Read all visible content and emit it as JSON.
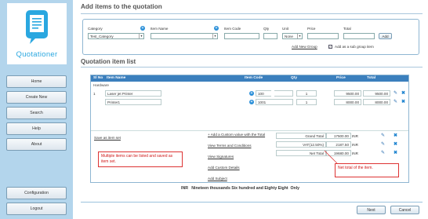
{
  "sidebar": {
    "logo_text": "Quotationer",
    "nav": [
      "Home",
      "Create New",
      "Search",
      "Help",
      "About"
    ],
    "bottom": [
      "Configuration",
      "Logout"
    ]
  },
  "header": {
    "title": "Add items to the quotation"
  },
  "form": {
    "category_label": "Category",
    "category_value": "Test_Category",
    "item_name_label": "Item Name",
    "item_name_value": "",
    "item_code_label": "Item Code",
    "qty_label": "Qty",
    "unit_label": "Unit",
    "unit_value": "None",
    "price_label": "Price",
    "total_label": "Total",
    "add_label": "Add",
    "add_new_group": "Add New Group",
    "add_sub_group": "Add as a sub group item",
    "sub_group_checked": true
  },
  "list": {
    "title": "Quotation item list",
    "headers": [
      "Sl No",
      "Item Name",
      "Item Code",
      "Qty",
      "Price",
      "Total"
    ],
    "group": "Hardware",
    "rows": [
      {
        "sl": "1",
        "name": "Laser jet Printer",
        "code": "100",
        "qty": "1",
        "price": "9500.00",
        "total": "9500.00"
      },
      {
        "sl": "",
        "name": "Printer1",
        "code": "1001",
        "qty": "1",
        "price": "8000.00",
        "total": "8000.00"
      }
    ],
    "links": {
      "save_as_item_set": "Save as item set",
      "add_custom_value": "+ Add a Custom value with the Total",
      "view_terms": "View Terms and Conditions",
      "view_signatures": "View Signatures",
      "add_custom_details": "Add Custom Details",
      "add_subject": "Add Subject"
    },
    "totals": [
      {
        "label": "Grand Total",
        "value": "17500.00",
        "unit": "INR"
      },
      {
        "label": "VAT(12.50%)",
        "value": "2187.50",
        "unit": "INR"
      },
      {
        "label": "Net Total",
        "value": "19680.00",
        "unit": "INR"
      }
    ],
    "annotation_left": "Multiple items can be listed and saved as item set.",
    "annotation_right": "Net total of the item.",
    "amount_words": "INR   Nineteen thousands Six hundred and Eighty Eight  Only"
  },
  "footer": {
    "next": "Next",
    "cancel": "Cancel"
  },
  "colors": {
    "accent": "#3b7fbd",
    "sidebar": "#b3d5ec",
    "annotation": "#d01818"
  }
}
